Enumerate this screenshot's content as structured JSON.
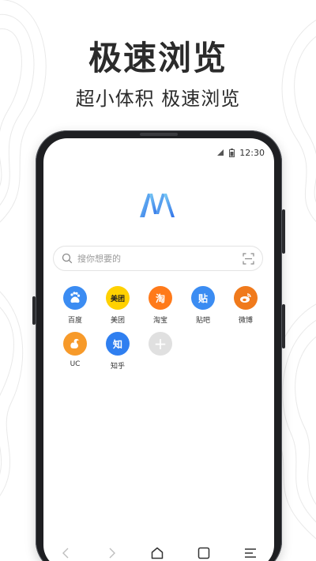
{
  "promo": {
    "headline": "极速浏览",
    "subline": "超小体积 极速浏览"
  },
  "status_bar": {
    "time": "12:30",
    "icons": [
      "signal-icon",
      "battery-icon"
    ]
  },
  "browser": {
    "logo_icon": "browser-logo-icon",
    "search": {
      "placeholder": "搜你想要的",
      "left_icon": "search-icon",
      "right_icon": "scan-icon"
    },
    "shortcuts": [
      {
        "label": "百度",
        "icon": "baidu-icon",
        "glyph": "",
        "color": "#3b8cf2"
      },
      {
        "label": "美团",
        "icon": "meituan-icon",
        "glyph": "美团",
        "color": "#ffd100"
      },
      {
        "label": "淘宝",
        "icon": "taobao-icon",
        "glyph": "淘",
        "color": "#ff7a1a"
      },
      {
        "label": "贴吧",
        "icon": "tieba-icon",
        "glyph": "贴",
        "color": "#3b8cf2"
      },
      {
        "label": "微博",
        "icon": "weibo-icon",
        "glyph": "",
        "color": "#f07a1c"
      },
      {
        "label": "UC",
        "icon": "uc-icon",
        "glyph": "",
        "color": "#f79a2a"
      },
      {
        "label": "知乎",
        "icon": "zhihu-icon",
        "glyph": "知",
        "color": "#2f7ff0"
      },
      {
        "label": "",
        "icon": "add-icon",
        "glyph": "+",
        "color": "#e0e0e0"
      }
    ],
    "nav": [
      "back-icon",
      "forward-icon",
      "home-icon",
      "tabs-icon",
      "menu-icon"
    ]
  },
  "colors": {
    "accent": "#3b8cf2",
    "phone_frame": "#1e1f22",
    "text_dark": "#2b2b2b"
  }
}
